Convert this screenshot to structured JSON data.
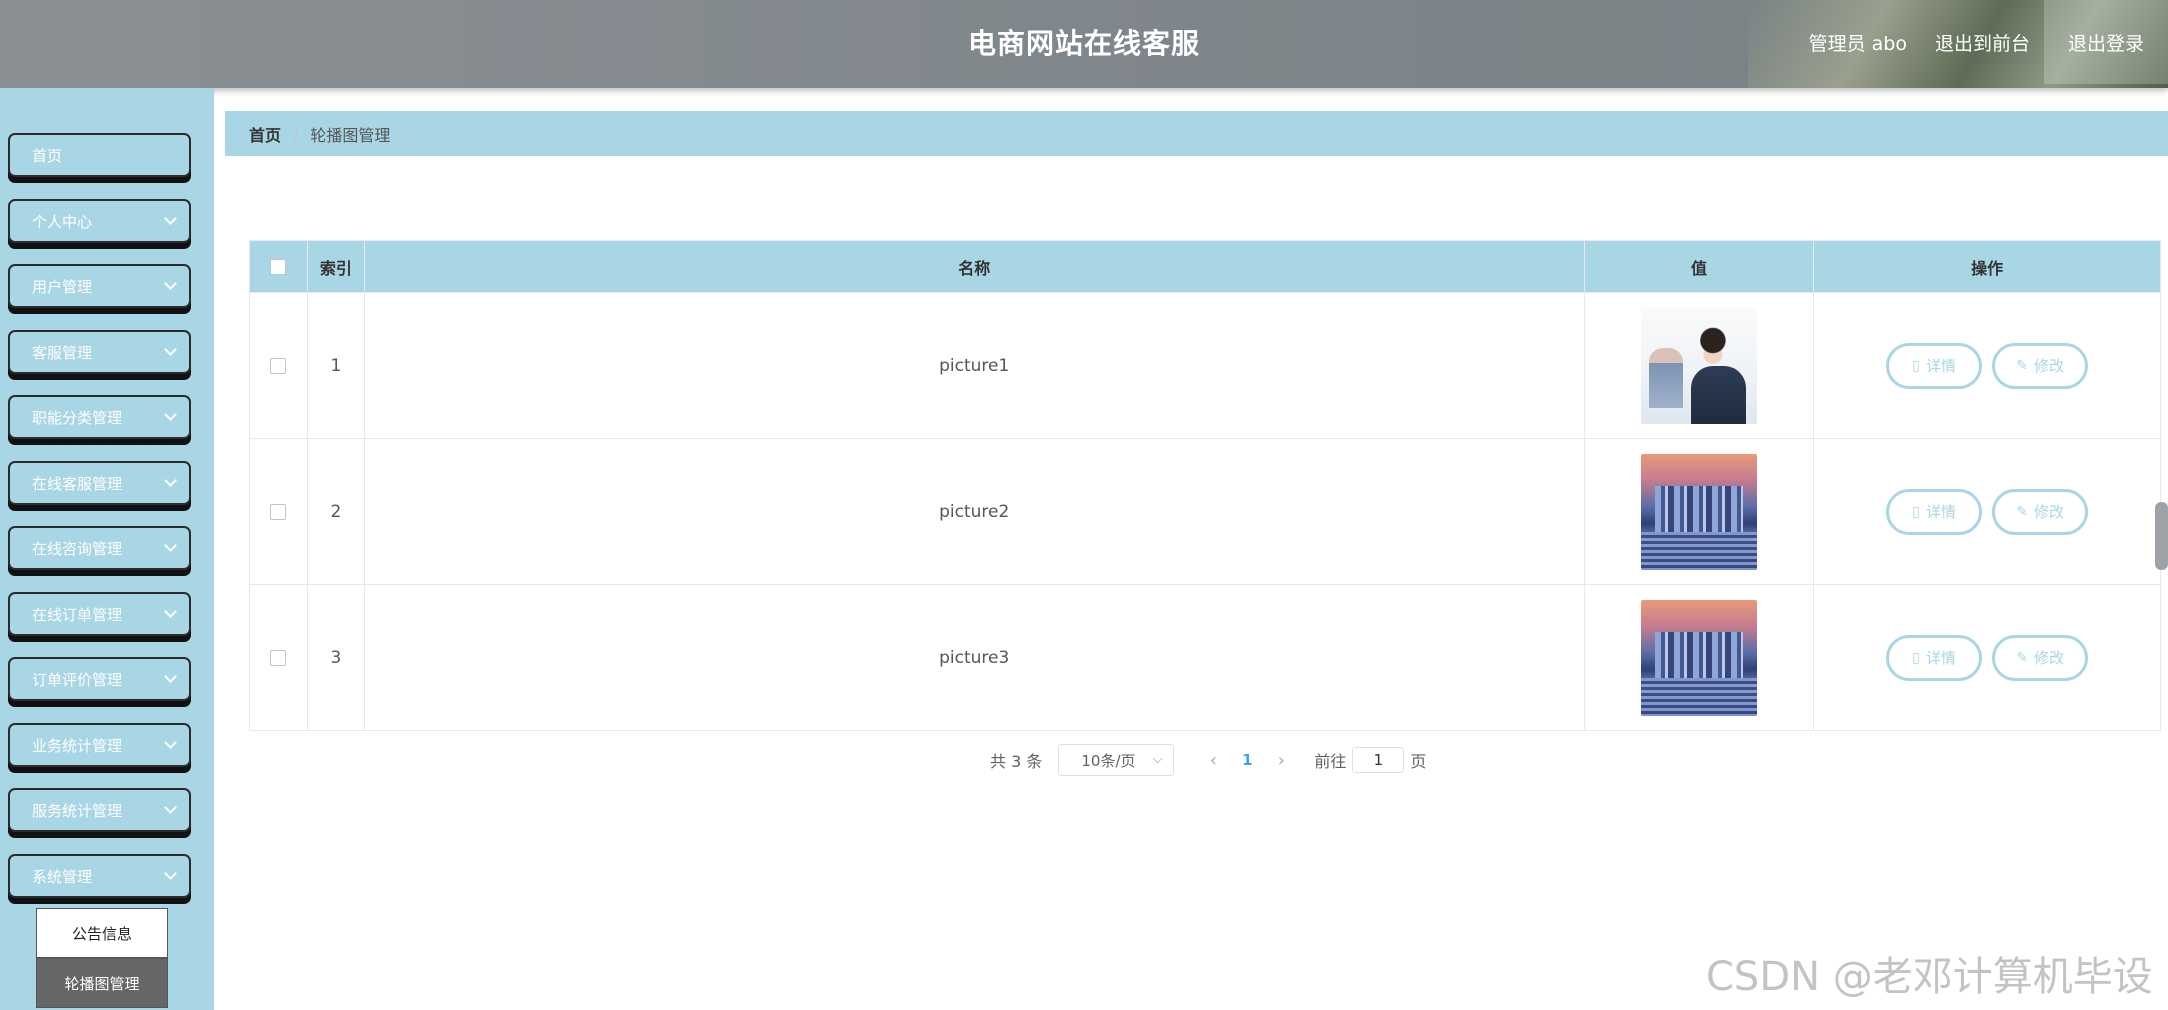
{
  "header": {
    "title": "电商网站在线客服",
    "admin_label": "管理员 abo",
    "front_link": "退出到前台",
    "logout_link": "退出登录"
  },
  "sidebar": {
    "items": [
      {
        "label": "首页",
        "has_children": false
      },
      {
        "label": "个人中心",
        "has_children": true
      },
      {
        "label": "用户管理",
        "has_children": true
      },
      {
        "label": "客服管理",
        "has_children": true
      },
      {
        "label": "职能分类管理",
        "has_children": true
      },
      {
        "label": "在线客服管理",
        "has_children": true
      },
      {
        "label": "在线咨询管理",
        "has_children": true
      },
      {
        "label": "在线订单管理",
        "has_children": true
      },
      {
        "label": "订单评价管理",
        "has_children": true
      },
      {
        "label": "业务统计管理",
        "has_children": true
      },
      {
        "label": "服务统计管理",
        "has_children": true
      },
      {
        "label": "系统管理",
        "has_children": true
      }
    ],
    "submenu": [
      {
        "label": "公告信息",
        "active": false
      },
      {
        "label": "轮播图管理",
        "active": true
      }
    ]
  },
  "breadcrumb": {
    "home": "首页",
    "current": "轮播图管理"
  },
  "table": {
    "headers": {
      "index": "索引",
      "name": "名称",
      "value": "值",
      "actions": "操作"
    },
    "rows": [
      {
        "index": "1",
        "name": "picture1",
        "image": "customer-service-staff"
      },
      {
        "index": "2",
        "name": "picture2",
        "image": "city-night-skyline"
      },
      {
        "index": "3",
        "name": "picture3",
        "image": "city-night-skyline"
      }
    ],
    "detail_label": "详情",
    "edit_label": "修改"
  },
  "pagination": {
    "total": "共 3 条",
    "page_size": "10条/页",
    "current_page": "1",
    "goto_prefix": "前往",
    "goto_value": "1",
    "goto_suffix": "页"
  },
  "watermark": "CSDN @老邓计算机毕设",
  "colors": {
    "accent": "#a9d6e5",
    "header": "#7f868b",
    "page_active": "#409eff"
  }
}
